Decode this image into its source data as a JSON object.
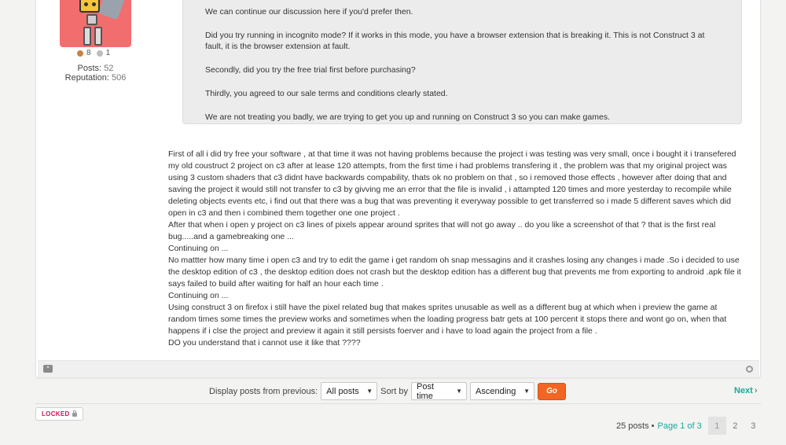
{
  "author": {
    "medals": [
      {
        "icon": "bronze-dot",
        "count": "8"
      },
      {
        "icon": "silver-dot",
        "count": "1"
      }
    ],
    "posts_label": "Posts:",
    "posts_value": "52",
    "rep_label": "Reputation:",
    "rep_value": "506"
  },
  "quote": {
    "paragraphs": [
      "We can continue our discussion here if you'd prefer then.",
      "Did you try running in incognito mode? If it works in this mode, you have a browser extension that is breaking it. This is not Construct 3 at fault, it is the browser extension at fault.",
      "Secondly, did you try the free trial first before purchasing?",
      "Thirdly, you agreed to our sale terms and conditions clearly stated.",
      "We are not treating you badly, we are trying to get you up and running on Construct 3 so you can make games."
    ]
  },
  "post": {
    "body": "First of all i did try free your software , at that time it was not having problems because the project i was testing was very small, once i bought it i transefered my old coustruct 2 project on c3 after at lease 120 attempts, from the first time i had problems transfering it , the problem was that my original project was using 3 custom shaders that c3 didnt have backwards compability, thats ok no problem on that , so i removed those effects , however after doing that and saving the project it would still not transfer to c3 by givving me an error that the file is invalid , i attampted 120 times and more yesterday to recompile while deleting objects events etc, i find out that there was a bug that was preventing it everyway possible to get transferred so i made 5 different saves which did open in c3 and then i combined them together one one project .\nAfter that when i open y project on c3 lines of pixels appear around sprites that will not go away .. do you like a screenshot of that ? that is the first real bug.....and a gamebreaking one ...\nContinuing on ...\nNo mattter how many time i open c3 and try to edit the game i get random oh snap messagins and it crashes losing any changes i made .So i decided to use the desktop edition of c3 , the desktop edition does not crash but the desktop edition has a different bug that prevents me from exporting to android .apk file it says failed to build after waiting for half an hour each time .\nContinuing on ...\nUsing construct 3 on firefox i still have the pixel related bug that makes sprites unusable as well as a different bug at which when i preview the game at random times some times the preview works and sometimes when the loading progress batr gets at 100 percent it stops there and wont go on, when that happens if i clse the project and preview it again it still persists foerver and i have to load again the project from a file .\nDO you understand that i cannot use it like that ????"
  },
  "sort_bar": {
    "display_label": "Display posts from previous:",
    "display_value": "All posts",
    "sort_label": "Sort by",
    "sort_value": "Post time",
    "order_value": "Ascending",
    "go_label": "Go"
  },
  "nav": {
    "next_label": "Next",
    "next_chevron": "›"
  },
  "locked_label": "LOCKED",
  "pagination": {
    "count_text": "25 posts •",
    "page_label": "Page 1 of 3",
    "pages": [
      "1",
      "2",
      "3"
    ],
    "current": "1"
  }
}
